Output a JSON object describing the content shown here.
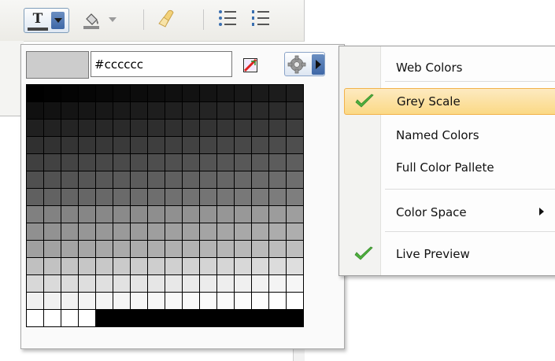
{
  "toolbar": {
    "items": [
      {
        "name": "text-color",
        "icon": "text-color-icon",
        "glyph": "T"
      },
      {
        "name": "background-color",
        "icon": "paint-bucket-icon"
      },
      {
        "name": "clear-formatting",
        "icon": "eraser-icon"
      },
      {
        "name": "bulleted-list",
        "icon": "bulleted-list-icon"
      },
      {
        "name": "numbered-list",
        "icon": "numbered-list-icon"
      }
    ]
  },
  "picker": {
    "current_color": "#cccccc",
    "hex_value": "#cccccc",
    "grid_rows": [
      [
        "#000000",
        "#020202",
        "#040404",
        "#060606",
        "#080808",
        "#0a0a0a",
        "#0c0c0c",
        "#0e0e0e",
        "#101010",
        "#121212",
        "#141414",
        "#161616",
        "#181818",
        "#1a1a1a",
        "#1c1c1c",
        "#1e1e1e"
      ],
      [
        "#101010",
        "#121212",
        "#141414",
        "#161616",
        "#181818",
        "#1a1a1a",
        "#1c1c1c",
        "#1e1e1e",
        "#202020",
        "#222222",
        "#242424",
        "#262626",
        "#282828",
        "#2a2a2a",
        "#2c2c2c",
        "#2e2e2e"
      ],
      [
        "#202020",
        "#222222",
        "#242424",
        "#262626",
        "#282828",
        "#2a2a2a",
        "#2c2c2c",
        "#2e2e2e",
        "#303030",
        "#323232",
        "#343434",
        "#363636",
        "#383838",
        "#3a3a3a",
        "#3c3c3c",
        "#3e3e3e"
      ],
      [
        "#303030",
        "#323232",
        "#343434",
        "#363636",
        "#383838",
        "#3a3a3a",
        "#3c3c3c",
        "#3e3e3e",
        "#404040",
        "#424242",
        "#444444",
        "#464646",
        "#484848",
        "#4a4a4a",
        "#4c4c4c",
        "#4e4e4e"
      ],
      [
        "#404040",
        "#424242",
        "#444444",
        "#464646",
        "#484848",
        "#4a4a4a",
        "#4c4c4c",
        "#4e4e4e",
        "#505050",
        "#525252",
        "#545454",
        "#565656",
        "#585858",
        "#5a5a5a",
        "#5c5c5c",
        "#5e5e5e"
      ],
      [
        "#505050",
        "#525252",
        "#545454",
        "#565656",
        "#585858",
        "#5a5a5a",
        "#5c5c5c",
        "#5e5e5e",
        "#606060",
        "#626262",
        "#646464",
        "#666666",
        "#686868",
        "#6a6a6a",
        "#6c6c6c",
        "#6e6e6e"
      ],
      [
        "#606060",
        "#626262",
        "#646464",
        "#666666",
        "#686868",
        "#6a6a6a",
        "#6c6c6c",
        "#6e6e6e",
        "#707070",
        "#727272",
        "#747474",
        "#767676",
        "#787878",
        "#7a7a7a",
        "#7c7c7c",
        "#7e7e7e"
      ],
      [
        "#808080",
        "#828282",
        "#848484",
        "#868686",
        "#888888",
        "#8a8a8a",
        "#8c8c8c",
        "#8e8e8e",
        "#909090",
        "#929292",
        "#949494",
        "#969696",
        "#989898",
        "#9a9a9a",
        "#9c9c9c",
        "#9e9e9e"
      ],
      [
        "#909090",
        "#929292",
        "#949494",
        "#969696",
        "#989898",
        "#9a9a9a",
        "#9c9c9c",
        "#9e9e9e",
        "#a0a0a0",
        "#a2a2a2",
        "#a4a4a4",
        "#a6a6a6",
        "#a8a8a8",
        "#aaaaaa",
        "#acacac",
        "#aeaeae"
      ],
      [
        "#a0a0a0",
        "#a2a2a2",
        "#a4a4a4",
        "#a6a6a6",
        "#a8a8a8",
        "#aaaaaa",
        "#acacac",
        "#aeaeae",
        "#b0b0b0",
        "#b2b2b2",
        "#b4b4b4",
        "#b6b6b6",
        "#b8b8b8",
        "#bababa",
        "#bcbcbc",
        "#bebebe"
      ],
      [
        "#c0c0c0",
        "#c2c2c2",
        "#c4c4c4",
        "#c6c6c6",
        "#c8c8c8",
        "#cacaca",
        "#cccccc",
        "#cecece",
        "#d0d0d0",
        "#d2d2d2",
        "#d4d4d4",
        "#d6d6d6",
        "#d8d8d8",
        "#dadada",
        "#dcdcdc",
        "#dedede"
      ],
      [
        "#d8d8d8",
        "#dadada",
        "#dcdcdc",
        "#dedede",
        "#e0e0e0",
        "#e2e2e2",
        "#e4e4e4",
        "#e6e6e6",
        "#e8e8e8",
        "#eaeaea",
        "#ececec",
        "#eeeeee",
        "#f0f0f0",
        "#f2f2f2",
        "#f4f4f4",
        "#f6f6f6"
      ],
      [
        "#f0f0f0",
        "#f1f1f1",
        "#f2f2f2",
        "#f3f3f3",
        "#f4f4f4",
        "#f5f5f5",
        "#f6f6f6",
        "#f7f7f7",
        "#f8f8f8",
        "#f9f9f9",
        "#fafafa",
        "#fbfbfb",
        "#fcfcfc",
        "#fdfdfd",
        "#fefefe",
        "#ffffff"
      ],
      [
        "#ffffff",
        "#ffffff",
        "#ffffff",
        "#ffffff",
        "#000000",
        "#000000",
        "#000000",
        "#000000",
        "#000000",
        "#000000",
        "#000000",
        "#000000",
        "#000000",
        "#000000",
        "#000000",
        "#000000"
      ]
    ]
  },
  "menu": {
    "items": [
      {
        "label": "Web Colors",
        "checked": false,
        "selected": false,
        "submenu": false
      },
      {
        "label": "Grey Scale",
        "checked": true,
        "selected": true,
        "submenu": false
      },
      {
        "label": "Named Colors",
        "checked": false,
        "selected": false,
        "submenu": false
      },
      {
        "label": "Full Color Pallete",
        "checked": false,
        "selected": false,
        "submenu": false
      },
      {
        "label": "Color Space",
        "checked": false,
        "selected": false,
        "submenu": true
      },
      {
        "label": "Live Preview",
        "checked": true,
        "selected": false,
        "submenu": false
      }
    ],
    "check_color": "#4caf3c",
    "highlight_border": "#f2b24a"
  }
}
